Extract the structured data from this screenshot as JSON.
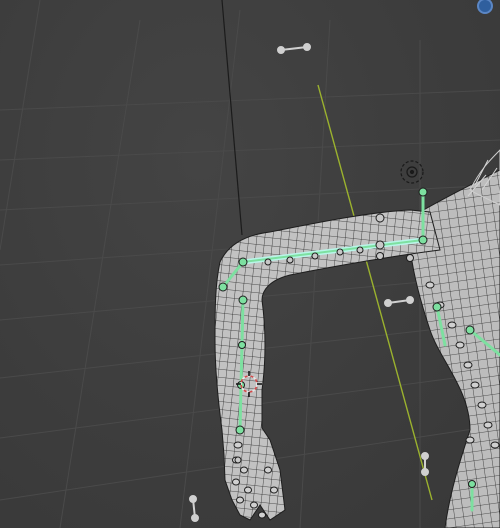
{
  "viewport": {
    "background": "#3d3d3d",
    "grid_color": "#4a4a4a",
    "axis_y_color": "#9bb22e",
    "axis_z_color": "#1b1b1b"
  },
  "armature": {
    "bone_color": "#7de0a0",
    "bone_selected_color": "#b8f5e8",
    "joint_color": "#c8c8c8",
    "ik_target_color": "#d0d0d0"
  },
  "mesh": {
    "fill_color": "#bdbdbd",
    "wire_color": "#1e1e1e"
  },
  "icons": {
    "navigation_gizmo": "axis-gizmo-icon",
    "cursor_3d": "3d-cursor-icon",
    "light_target": "light-target-icon"
  }
}
